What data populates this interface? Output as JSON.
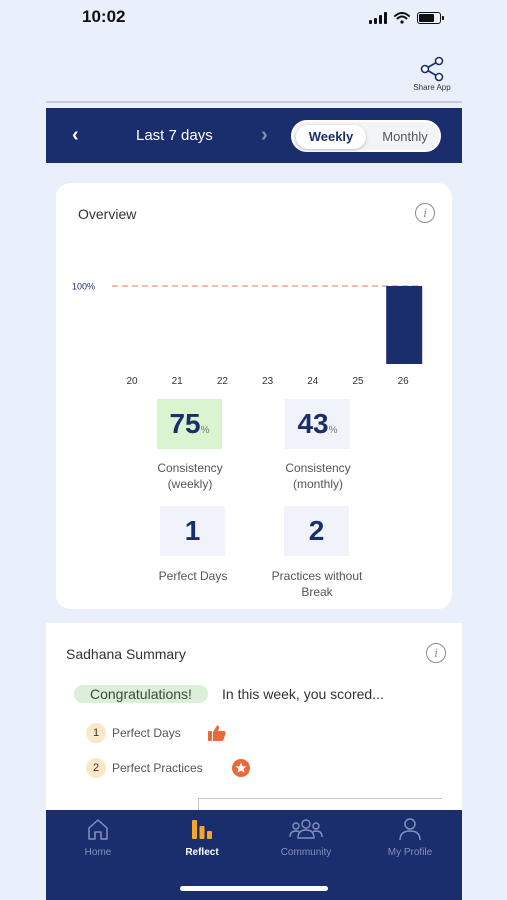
{
  "status_bar": {
    "time": "10:02"
  },
  "header": {
    "share_label": "Share App"
  },
  "period_nav": {
    "prev_icon": "chevron-left-icon",
    "next_icon": "chevron-right-icon",
    "label": "Last 7 days",
    "toggle": {
      "options": [
        "Weekly",
        "Monthly"
      ],
      "selected": "Weekly"
    }
  },
  "overview": {
    "title": "Overview",
    "chart_data": {
      "type": "bar",
      "categories": [
        "20",
        "21",
        "22",
        "23",
        "24",
        "25",
        "26"
      ],
      "values": [
        0,
        0,
        0,
        0,
        0,
        0,
        100
      ],
      "reference_line": {
        "value": 100,
        "label": "100%"
      },
      "ylim": [
        0,
        100
      ],
      "title": "",
      "xlabel": "",
      "ylabel": "",
      "bar_color": "#1a2e6e",
      "reference_color": "#f0a78d"
    },
    "stats": [
      {
        "value": "75",
        "unit": "%",
        "label_line1": "Consistency",
        "label_line2": "(weekly)"
      },
      {
        "value": "43",
        "unit": "%",
        "label_line1": "Consistency",
        "label_line2": "(monthly)"
      },
      {
        "value": "1",
        "unit": "",
        "label_line1": "Perfect Days",
        "label_line2": ""
      },
      {
        "value": "2",
        "unit": "",
        "label_line1": "Practices without",
        "label_line2": "Break"
      }
    ]
  },
  "summary": {
    "title": "Sadhana Summary",
    "congrats": "Congratulations!",
    "congrats_rest": "In this week, you scored...",
    "items": [
      {
        "num": "1",
        "label": "Perfect Days",
        "icon": "thumbs-up-icon"
      },
      {
        "num": "2",
        "label": "Perfect Practices",
        "icon": "star-badge-icon"
      }
    ]
  },
  "tabs": [
    {
      "label": "Home",
      "icon": "home-icon"
    },
    {
      "label": "Reflect",
      "icon": "bar-chart-icon"
    },
    {
      "label": "Community",
      "icon": "community-icon"
    },
    {
      "label": "My Profile",
      "icon": "profile-icon"
    }
  ],
  "active_tab": "Reflect",
  "colors": {
    "primary": "#1a2e6e",
    "background": "#e9effb",
    "accent": "#e9693a"
  }
}
